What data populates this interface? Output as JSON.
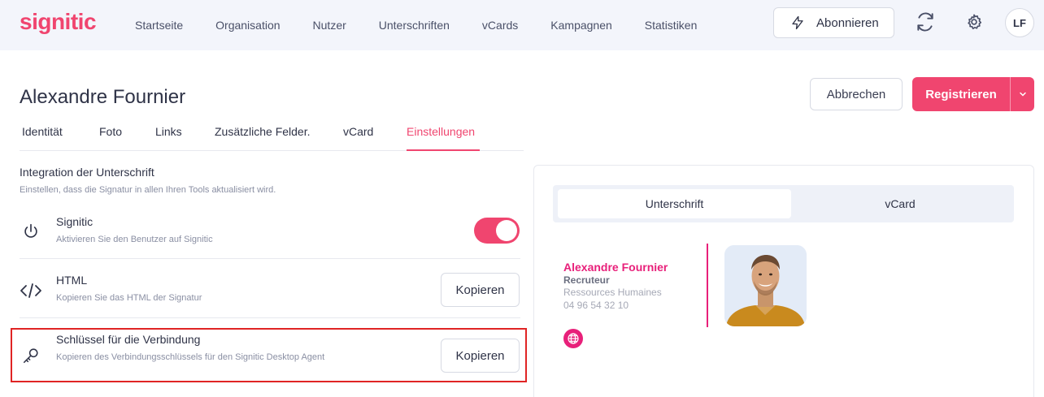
{
  "app": {
    "logo": "signitic"
  },
  "nav": {
    "items": [
      "Startseite",
      "Organisation",
      "Nutzer",
      "Unterschriften",
      "vCards",
      "Kampagnen",
      "Statistiken"
    ],
    "subscribe_label": "Abonnieren",
    "user_initials": "LF"
  },
  "page": {
    "title": "Alexandre Fournier",
    "cancel_label": "Abbrechen",
    "register_label": "Registrieren"
  },
  "tabs": {
    "items": [
      "Identität",
      "Foto",
      "Links",
      "Zusätzliche Felder.",
      "vCard",
      "Einstellungen"
    ],
    "active": "Einstellungen"
  },
  "integration": {
    "title": "Integration der Unterschrift",
    "subtitle": "Einstellen, dass die Signatur in allen Ihren Tools aktualisiert wird.",
    "rows": [
      {
        "icon": "power-icon",
        "title": "Signitic",
        "desc": "Aktivieren Sie den Benutzer auf Signitic",
        "control": "toggle",
        "enabled": true
      },
      {
        "icon": "code-icon",
        "title": "HTML",
        "desc": "Kopieren Sie das HTML der Signatur",
        "control": "button",
        "button_label": "Kopieren"
      },
      {
        "icon": "key-icon",
        "title": "Schlüssel für die Verbindung",
        "desc": "Kopieren des Verbindungsschlüssels für den Signitic Desktop Agent",
        "control": "button",
        "button_label": "Kopieren"
      }
    ]
  },
  "preview": {
    "tabs": [
      "Unterschrift",
      "vCard"
    ],
    "active_tab": "Unterschrift",
    "signature": {
      "name": "Alexandre Fournier",
      "role": "Recruteur",
      "department": "Ressources Humaines",
      "phone": "04 96 54 32 10"
    }
  },
  "colors": {
    "brand": "#f0456f",
    "signature_accent": "#e8207a",
    "highlight": "#e02424"
  }
}
